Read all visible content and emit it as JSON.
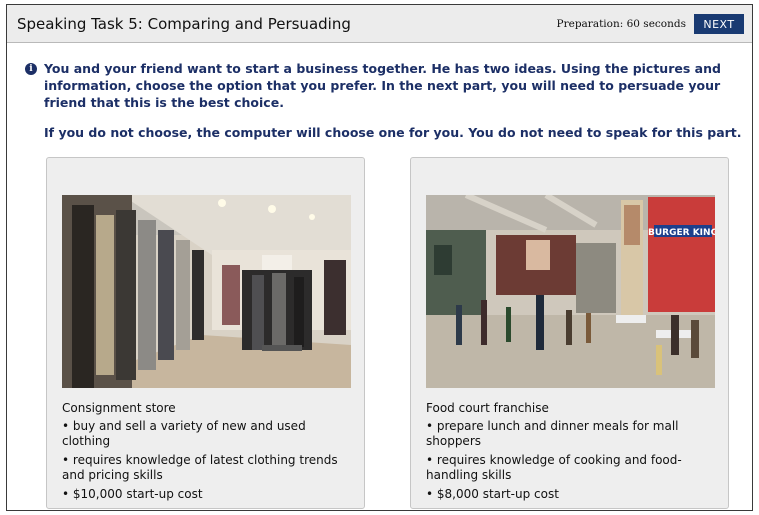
{
  "header": {
    "title": "Speaking Task 5: Comparing and Persuading",
    "preparation": "Preparation: 60 seconds",
    "next_label": "NEXT"
  },
  "instructions": {
    "icon": "info-icon",
    "paragraph1": "You and your friend want to start a business together. He has two ideas. Using the pictures and information, choose the option that you prefer. In the next part, you will need to persuade your friend that this is the best choice.",
    "paragraph2": "If you do not choose, the computer will choose one for you. You do not need to speak for this part."
  },
  "options": [
    {
      "name": "Consignment store",
      "bullets": [
        "• buy and sell a variety of new and used clothing",
        "• requires knowledge of latest clothing trends and pricing skills",
        "• $10,000 start-up cost"
      ]
    },
    {
      "name": "Food court franchise",
      "bullets": [
        "• prepare lunch and dinner meals for mall shoppers",
        "• requires knowledge of cooking and food-handling skills",
        "• $8,000 start-up cost"
      ]
    }
  ],
  "photo_signage": "BURGER KING",
  "colors": {
    "accent_text": "#1c2f66",
    "next_button": "#193a72",
    "header_bg": "#ececec",
    "card_bg": "#eeeeee"
  }
}
